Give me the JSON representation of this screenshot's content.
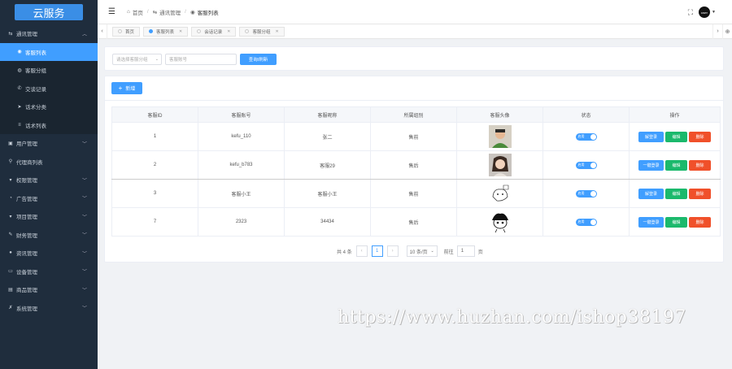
{
  "logo": {
    "text": "云服务"
  },
  "sidebar": {
    "groups": [
      {
        "label": "通讯管理",
        "icon": "chat-icon",
        "expanded": true,
        "children": [
          {
            "label": "客服列表",
            "icon": "user-icon",
            "active": true
          },
          {
            "label": "客服分组",
            "icon": "group-icon",
            "active": false
          },
          {
            "label": "交谈记录",
            "icon": "phone-icon",
            "active": false
          },
          {
            "label": "话术分类",
            "icon": "send-icon",
            "active": false
          },
          {
            "label": "话术列表",
            "icon": "list-icon",
            "active": false
          }
        ]
      },
      {
        "label": "用户管理",
        "icon": "users-icon"
      },
      {
        "label": "代理商列表",
        "icon": "agent-icon"
      },
      {
        "label": "权限管理",
        "icon": "lock-icon"
      },
      {
        "label": "广告管理",
        "icon": "ad-icon"
      },
      {
        "label": "项目管理",
        "icon": "project-icon"
      },
      {
        "label": "财务管理",
        "icon": "finance-icon"
      },
      {
        "label": "资讯管理",
        "icon": "news-icon"
      },
      {
        "label": "设备管理",
        "icon": "device-icon"
      },
      {
        "label": "商品管理",
        "icon": "goods-icon"
      },
      {
        "label": "系统管理",
        "icon": "wrench-icon"
      }
    ]
  },
  "header": {
    "breadcrumb": [
      "首页",
      "通讯管理",
      "客服列表"
    ],
    "avatar_text": "user"
  },
  "tabs": [
    {
      "label": "首页",
      "active": false,
      "closable": false
    },
    {
      "label": "客服列表",
      "active": true,
      "closable": true
    },
    {
      "label": "会话记录",
      "active": false,
      "closable": true
    },
    {
      "label": "客服分组",
      "active": false,
      "closable": true
    }
  ],
  "filter": {
    "select_placeholder": "请选择客服分组",
    "input_placeholder": "客服账号",
    "query_label": "查询/刷新"
  },
  "toolbar": {
    "add_label": "新增"
  },
  "table": {
    "columns": [
      "客服ID",
      "客服账号",
      "客服昵称",
      "所属组别",
      "客服头像",
      "状态",
      "操作"
    ],
    "rows": [
      {
        "id": "1",
        "account": "kefu_110",
        "nickname": "张二",
        "group": "售前",
        "avatar": "avatar-green-shirt",
        "status": "启用",
        "op1": "解登录",
        "op2": "编辑",
        "op3": "删除"
      },
      {
        "id": "2",
        "account": "kefu_b783",
        "nickname": "客服29",
        "group": "售后",
        "avatar": "avatar-girl",
        "status": "启用",
        "op1": "一键登录",
        "op2": "编辑",
        "op3": "删除"
      },
      {
        "id": "3",
        "account": "客服小王",
        "nickname": "客服小王",
        "group": "售前",
        "avatar": "avatar-sketch",
        "status": "启用",
        "op1": "解登录",
        "op2": "编辑",
        "op3": "删除"
      },
      {
        "id": "7",
        "account": "2323",
        "nickname": "34434",
        "group": "售后",
        "avatar": "avatar-cartoon",
        "status": "启用",
        "op1": "一键登录",
        "op2": "编辑",
        "op3": "删除"
      }
    ]
  },
  "pagination": {
    "total_text": "共 4 条",
    "current_page": "1",
    "page_size": "10 条/页",
    "goto_label": "前往",
    "goto_value": "1",
    "page_suffix": "页"
  },
  "watermark": "https://www.huzhan.com/ishop38197",
  "colors": {
    "primary": "#409eff",
    "success": "#1bb96c",
    "danger": "#f0502a",
    "sidebar": "#1f2d3d"
  }
}
